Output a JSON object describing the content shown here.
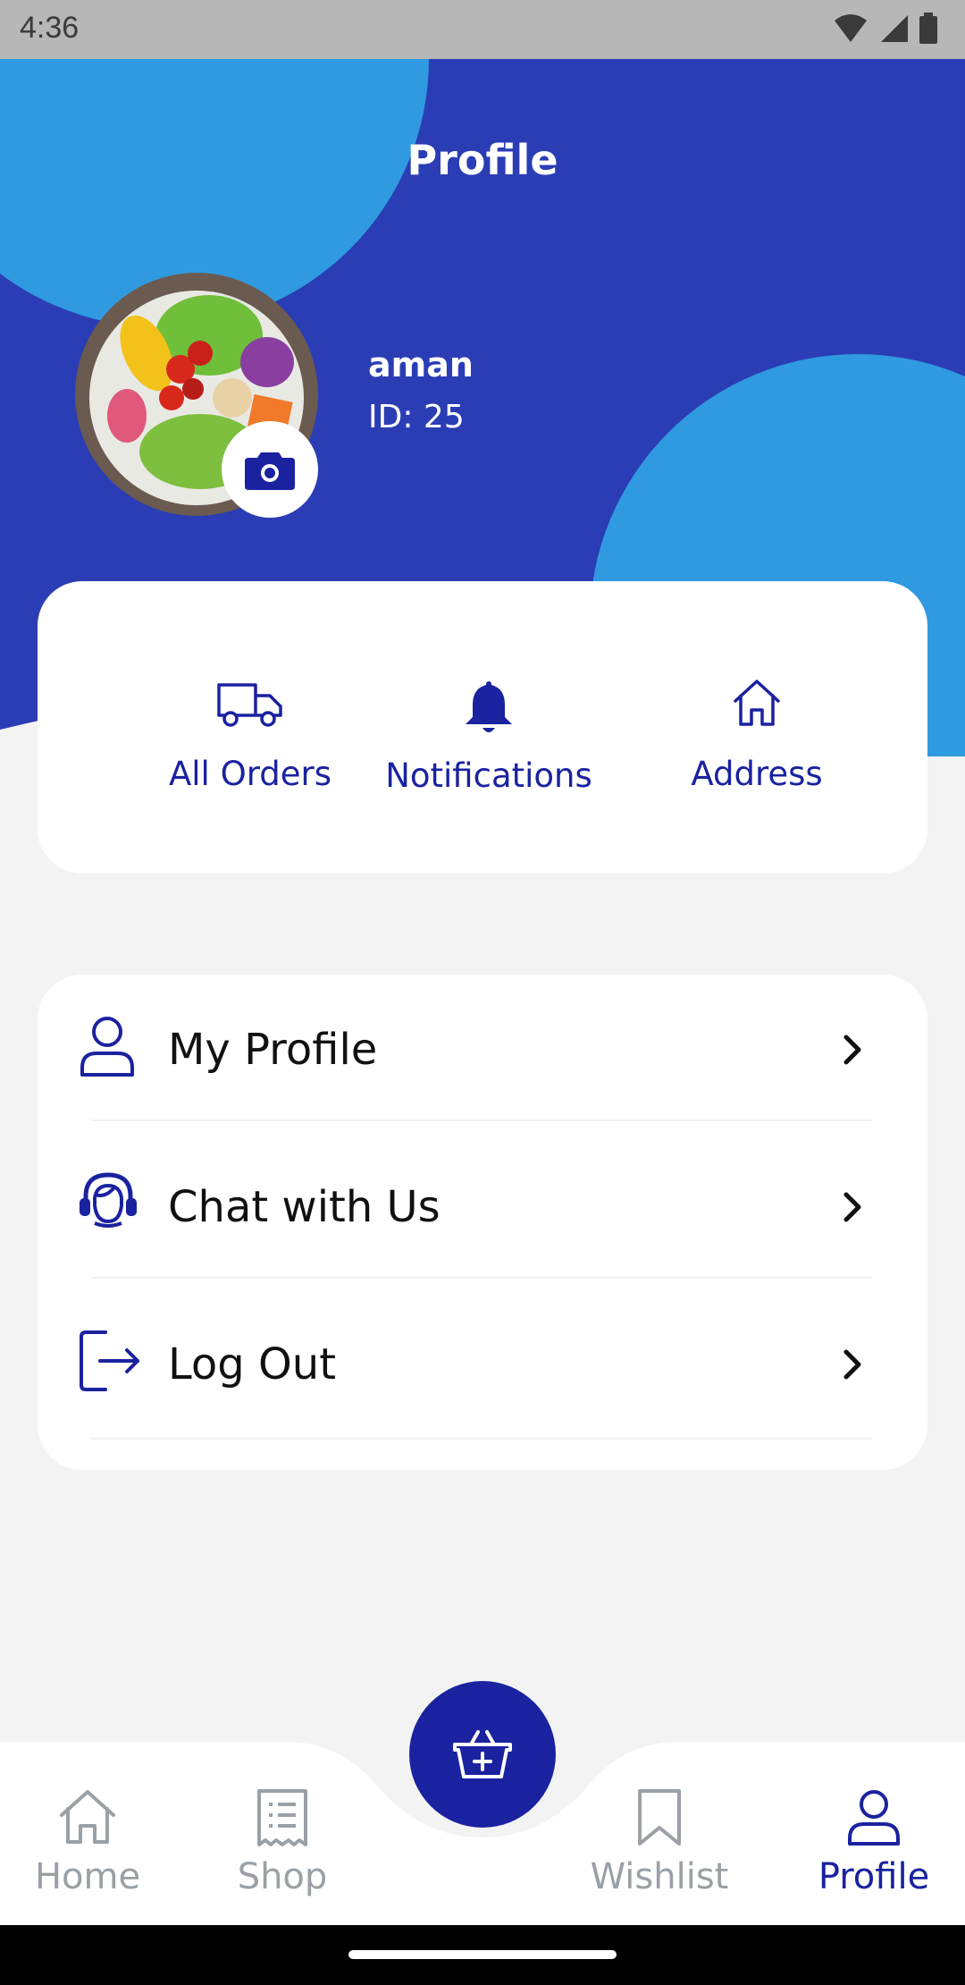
{
  "status_bar": {
    "time": "4:36"
  },
  "header": {
    "title": "Profile",
    "bg_color": "#2b3db5",
    "accent_color": "#2f9ae0"
  },
  "user": {
    "name": "aman",
    "id_label": "ID: 25"
  },
  "quick_actions": [
    {
      "label": "All Orders",
      "icon": "truck-icon"
    },
    {
      "label": "Notifications",
      "icon": "bell-icon"
    },
    {
      "label": "Address",
      "icon": "home-icon"
    }
  ],
  "menu": [
    {
      "label": "My Profile",
      "icon": "user-icon"
    },
    {
      "label": "Chat with Us",
      "icon": "headset-icon"
    },
    {
      "label": "Log Out",
      "icon": "logout-icon"
    }
  ],
  "bottom_nav": {
    "items": [
      {
        "label": "Home",
        "icon": "home-icon",
        "active": false
      },
      {
        "label": "Shop",
        "icon": "receipt-icon",
        "active": false
      },
      {
        "label": "Wishlist",
        "icon": "bookmark-icon",
        "active": false
      },
      {
        "label": "Profile",
        "icon": "user-icon",
        "active": true
      }
    ],
    "center_button_icon": "basket-plus-icon",
    "active_color": "#1a22a0",
    "inactive_color": "#9aa0a6"
  }
}
